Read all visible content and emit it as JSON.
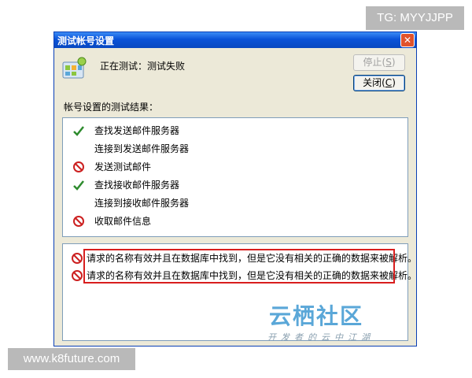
{
  "watermark": {
    "tg": "TG: MYYJJPP",
    "site": "www.k8future.com",
    "yunqi_title": "云栖社区",
    "yunqi_sub": "开发者的云中江湖"
  },
  "dialog": {
    "title": "测试帐号设置",
    "close_glyph": "✕",
    "status": "正在测试：测试失败",
    "stop_button": {
      "text": "停止(",
      "key": "S",
      "end": ")"
    },
    "close_button": {
      "text": "关闭(",
      "key": "C",
      "end": ")"
    },
    "results_label": "帐号设置的测试结果：",
    "tasks": [
      {
        "label": "查找发送邮件服务器",
        "status": "success"
      },
      {
        "label": "连接到发送邮件服务器",
        "status": "none"
      },
      {
        "label": "发送测试邮件",
        "status": "failed"
      },
      {
        "label": "查找接收邮件服务器",
        "status": "success"
      },
      {
        "label": "连接到接收邮件服务器",
        "status": "none"
      },
      {
        "label": "收取邮件信息",
        "status": "failed"
      }
    ],
    "errors": [
      {
        "message": "请求的名称有效并且在数据库中找到，但是它没有相关的正确的数据来被解析。"
      },
      {
        "message": "请求的名称有效并且在数据库中找到，但是它没有相关的正确的数据来被解析。"
      }
    ]
  },
  "colors": {
    "success": "#2e8b2e",
    "failed": "#cc2020",
    "highlight": "#d81e1e",
    "titlebar": "#0a52d8"
  }
}
